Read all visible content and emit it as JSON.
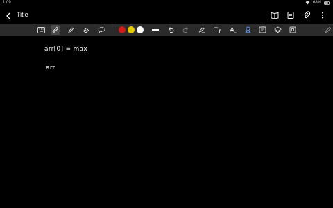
{
  "status": {
    "time": "1:09",
    "battery": "68%"
  },
  "header": {
    "title": "Title"
  },
  "icons": {
    "back": "chevron-left-icon",
    "book": "book-icon",
    "notes": "notes-icon",
    "attach": "paperclip-icon",
    "more": "more-vertical-icon",
    "keyboard": "keyboard-icon",
    "pen": "pen-icon",
    "highlighter": "highlighter-icon",
    "eraser": "eraser-icon",
    "lasso": "lasso-icon",
    "undo": "undo-icon",
    "redo": "redo-icon",
    "text": "text-icon",
    "shapes": "shapes-icon",
    "insert": "insert-icon",
    "zoom": "zoom-icon"
  },
  "toolbar": {
    "colors": [
      "#d11a1a",
      "#e6c800",
      "#ffffff"
    ]
  },
  "canvas": {
    "lines": [
      "arr[0] = max",
      "arr"
    ]
  }
}
